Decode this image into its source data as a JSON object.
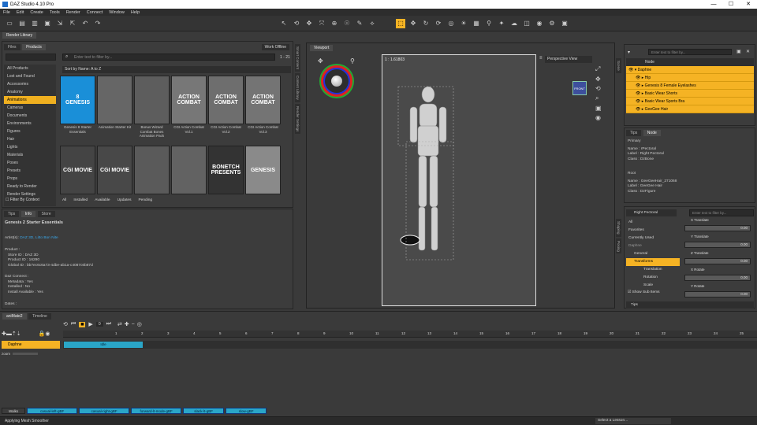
{
  "window": {
    "title": "DAZ Studio 4.10 Pro",
    "min": "—",
    "max": "☐",
    "close": "✕"
  },
  "menu": [
    "File",
    "Edit",
    "Create",
    "Tools",
    "Render",
    "Connect",
    "Window",
    "Help"
  ],
  "render_library_tab": "Render Library",
  "content": {
    "tabs": [
      "Files",
      "Products"
    ],
    "work_offline": "Work Offline",
    "filter_placeholder": "Enter text to filter by...",
    "page_range": "1 - 21",
    "sort": "Sort by Name: A to Z",
    "categories": [
      "All Products",
      "Lost and Found",
      "Accessories",
      "Anatomy",
      "Animations",
      "Cameras",
      "Documents",
      "Environments",
      "Figures",
      "Hair",
      "Lights",
      "Materials",
      "Poses",
      "Presets",
      "Props",
      "Ready to Render",
      "Render Settings"
    ],
    "selected_category": "Animations",
    "filter_by_context": "Filter By Context",
    "thumbs": [
      {
        "img": "8\nGENESIS",
        "cap": "Genesis 8 Starter Essentials"
      },
      {
        "img": "",
        "cap": "Animation Starter Kit"
      },
      {
        "img": "",
        "cap": "Bonus Wizard Combat Bones Animation Pack"
      },
      {
        "img": "ACTION\nCOMBAT",
        "cap": "CGI Action Combat Vol.1"
      },
      {
        "img": "ACTION\nCOMBAT",
        "cap": "CGI Action Combat Vol.2"
      },
      {
        "img": "ACTION\nCOMBAT",
        "cap": "CGI Action Combat Vol.3"
      },
      {
        "img": "CGI MOVIE",
        "cap": ""
      },
      {
        "img": "CGI MOVIE",
        "cap": ""
      },
      {
        "img": "",
        "cap": ""
      },
      {
        "img": "",
        "cap": ""
      },
      {
        "img": "BONETCH\nPRESENTS",
        "cap": ""
      },
      {
        "img": "GENESIS",
        "cap": ""
      }
    ],
    "filters": [
      "All",
      "Installed",
      "Available",
      "Updates",
      "Pending"
    ]
  },
  "info": {
    "tabs": [
      "Tips",
      "Info",
      "Store"
    ],
    "title": "Genesis 2 Starter Essentials",
    "artists_label": "Artist(s):",
    "artists": "DAZ 3D, Litto Bon Nite",
    "product_header": "Product :",
    "store_id": "Store ID :  DAZ 3D",
    "product_id": "Product ID :  16290",
    "global_id": "Global ID :  bb7ec6c6a73-4dbe-ab1a-c4087c6b87d",
    "connect_header": "Daz Connect :",
    "metadata": "Metadata :  Yes",
    "installed": "Installed :  No",
    "install_avail": "Install Available :  Yes",
    "dates": "Dates :"
  },
  "left_vtabs": [
    "Smart Content",
    "Content Library",
    "Render Settings"
  ],
  "viewport": {
    "tab": "Viewport",
    "frame_label": "1 : 1.61803",
    "camera": "Perspective View",
    "cube_label": "FRONT"
  },
  "scene": {
    "filter_placeholder": "Enter text to filter by...",
    "node_header": "Node",
    "rows": [
      "Daphne",
      "Hip",
      "Genesis 8 Female Eyelashes",
      "Basic Wear Shorts",
      "Basic Wear Sports Bra",
      "GeeGee Hair"
    ],
    "vtabs": [
      "Scene",
      "Shaping",
      "Posing"
    ]
  },
  "props": {
    "tabs": [
      "Tips",
      "Node"
    ],
    "primary": "Primary",
    "p_name": "Name :  rPectoral",
    "p_label": "Label :  Right Pectoral",
    "p_class": "Class :  DzBone",
    "root": "Root",
    "r_name": "Name :  GeeGeeHair_271068",
    "r_label": "Label :  GeeGee Hair",
    "r_class": "Class :  DzFigure"
  },
  "params": {
    "node_select": "Right Pectoral",
    "filter_placeholder": "Enter text to filter by...",
    "tree": [
      "All",
      "Favorites",
      "Currently Used",
      "Daphne",
      "General",
      "Transforms",
      "Translation",
      "Rotation",
      "Scale"
    ],
    "show_sub": "Show Sub Items",
    "sliders": [
      {
        "label": "X Translate",
        "value": "0.00"
      },
      {
        "label": "Y Translate",
        "value": "0.00"
      },
      {
        "label": "Z Translate",
        "value": "0.00"
      },
      {
        "label": "X Rotate",
        "value": "0.00"
      },
      {
        "label": "Y Rotate",
        "value": "0.00"
      }
    ],
    "tips": "Tips"
  },
  "timeline": {
    "tabs": [
      "aniMate2",
      "Timeline"
    ],
    "frame": "0",
    "figure": "Daphne",
    "zoom": "zoom",
    "clip": "Idle",
    "ticks": [
      "1",
      "2",
      "3",
      "4",
      "5",
      "6",
      "7",
      "8",
      "9",
      "10",
      "11",
      "12",
      "13",
      "14",
      "15",
      "16",
      "17",
      "18",
      "19",
      "20",
      "21",
      "22",
      "23",
      "24",
      "25",
      "26"
    ],
    "walks": "Walks",
    "layers": [
      "casual-left-gBF",
      "casual-right-gBF",
      "forward-lt-mode-gBF",
      "slack-lt-gBF",
      "slow-gBF"
    ]
  },
  "status": {
    "left": "Applying Mesh Smoother",
    "lesson": "Select a Lesson..."
  },
  "colors": {
    "accent": "#f5b324",
    "clip": "#2aa6c8"
  }
}
